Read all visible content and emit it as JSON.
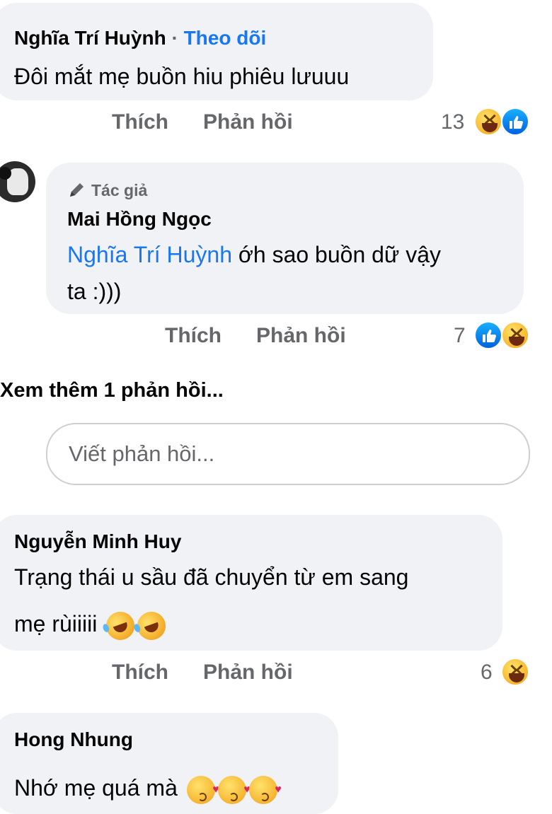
{
  "comments": [
    {
      "name": "Nghĩa Trí Huỳnh",
      "separator": "·",
      "follow_label": "Theo dõi",
      "text": "Đôi mắt mẹ buồn hiu phiêu lưuuu",
      "like_label": "Thích",
      "reply_label": "Phản hồi",
      "reaction_count": "13",
      "reactions": [
        "haha-icon",
        "like-icon"
      ]
    },
    {
      "author_badge": "Tác giả",
      "name": "Mai Hồng Ngọc",
      "mention": "Nghĩa Trí Huỳnh",
      "text_line1": " ớh sao buồn dữ vậy",
      "text_line2": "ta :)))",
      "like_label": "Thích",
      "reply_label": "Phản hồi",
      "reaction_count": "7",
      "reactions": [
        "like-icon",
        "haha-icon"
      ]
    },
    {
      "name": "Nguyễn Minh Huy",
      "text_line1": "Trạng thái u sầu đã chuyển từ em sang",
      "text_line2": "mẹ rùiiiii",
      "like_label": "Thích",
      "reply_label": "Phản hồi",
      "reaction_count": "6",
      "reactions": [
        "haha-icon"
      ]
    },
    {
      "name": "Hong Nhung",
      "text": "Nhớ mẹ quá mà"
    }
  ],
  "view_more": "Xem thêm 1 phản hồi...",
  "reply_input": {
    "placeholder": "Viết phản hồi..."
  },
  "colors": {
    "link": "#1877f2",
    "bubble": "#f0f2f5",
    "muted": "#65676b"
  }
}
